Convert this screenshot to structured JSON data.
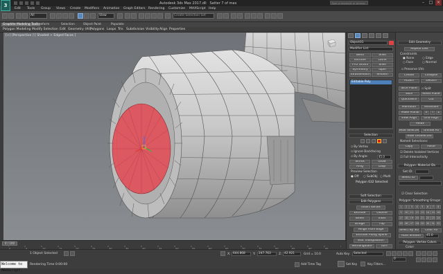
{
  "app": {
    "logo": "3",
    "title": "Autodesk 3ds Max 2017.dll",
    "title_suffix": "Satter 7 of max",
    "search_placeholder": "Type a keyword or phrase",
    "minimize": "–",
    "maximize": "□",
    "close": "×"
  },
  "menu": [
    "Edit",
    "Tools",
    "Group",
    "Views",
    "Create",
    "Modifiers",
    "Animation",
    "Graph Editors",
    "Rendering",
    "Customize",
    "MAXScript",
    "Help"
  ],
  "toolbar": {
    "selection_filter": "All",
    "reference_coord": "View",
    "named_selection": "Create Selection Set"
  },
  "ribbon_tabs": [
    "Graphite Modeling Tools",
    "Freeform",
    "Selection",
    "Object Paint",
    "Populate"
  ],
  "ribbon_sub": [
    "Polygon Modeling",
    "Modify Selection",
    "Edit",
    "Geometry (All)",
    "Polygons",
    "Loops",
    "Tris",
    "Subdivision",
    "Visibility",
    "Align",
    "Properties"
  ],
  "viewport": {
    "label": "[+] [Perspective ] [ Shaded + Edged Faces ]",
    "viewcube_label": "TOP"
  },
  "command_panel": {
    "object_name": "Object01",
    "modifier_list": "Modifier List",
    "modifier_buttons": [
      [
        "Bend",
        "Shell"
      ],
      [
        "Extrude",
        "Lathe"
      ],
      [
        "FFD 3x3x3",
        "Shell"
      ],
      [
        "Symmetry",
        "Taper"
      ],
      [
        "TurboSmooth",
        "Smooth"
      ]
    ],
    "stack_item": "Editable Poly",
    "selection_header": "Selection",
    "by_vertex": "By Vertex",
    "ignore_backfacing": "Ignore Backfacing",
    "by_angle": "By Angle:",
    "by_angle_value": "45.0",
    "shrink": "Shrink",
    "grow": "Grow",
    "ring": "Ring",
    "loop": "Loop",
    "preview_selection": "Preview Selection",
    "off": "Off",
    "subobj": "SubObj",
    "multi": "Multi",
    "selection_status": "Polygon 632 Selected",
    "soft_selection": "Soft Selection",
    "edit_polygons": "Edit Polygons",
    "insert_vertex": "Insert Vertex",
    "extrude": "Extrude",
    "outline": "Outline",
    "bevel": "Bevel",
    "inset": "Inset",
    "bridge": "Bridge",
    "flip": "Flip",
    "hinge": "Hinge From Edge",
    "extrude_spline": "Extrude Along Spline",
    "edit_triangulation": "Edit Triangulation",
    "retriangulate": "Retriangulate",
    "turn": "Turn"
  },
  "right_panel": {
    "edit_geometry": "Edit Geometry",
    "repeat_last": "Repeat Last",
    "constraints": "Constraints",
    "none": "None",
    "edge": "Edge",
    "face": "Face",
    "normal": "Normal",
    "preserve_uvs": "Preserve UVs",
    "create": "Create",
    "collapse": "Collapse",
    "attach": "Attach",
    "detach": "Detach",
    "slice_plane": "Slice Plane",
    "split": "Split",
    "slice": "Slice",
    "reset_plane": "Reset Plane",
    "quickslice": "QuickSlice",
    "cut": "Cut",
    "msmooth": "MSmooth",
    "tessellate": "Tessellate",
    "make_planar": "Make Planar",
    "x": "X",
    "y": "Y",
    "z": "Z",
    "view_align": "View Align",
    "grid_align": "Grid Align",
    "relax": "Relax",
    "hide_selected": "Hide Selected",
    "unhide_all": "Unhide All",
    "hide_unselected": "Hide Unselected",
    "named_selections": "Named Selections:",
    "copy": "Copy",
    "paste": "Paste",
    "delete_isolated": "Delete Isolated Vertices",
    "full_interactivity": "Full Interactivity",
    "material_ids": "Polygon: Material IDs",
    "set_id": "Set ID:",
    "select_id": "Select ID",
    "clear_selection": "Clear Selection",
    "smoothing_groups": "Polygon: Smoothing Groups",
    "select_by_sg": "Select By SG",
    "clear_all": "Clear All",
    "auto_smooth": "Auto Smooth",
    "auto_smooth_value": "45.0",
    "vertex_colors": "Polygon: Vertex Colors",
    "color": "Color:",
    "sg_numbers": [
      "1",
      "2",
      "3",
      "4",
      "5",
      "6",
      "7",
      "8",
      "9",
      "10",
      "11",
      "12",
      "13",
      "14",
      "15",
      "16",
      "17",
      "18",
      "19",
      "20",
      "21",
      "22",
      "23",
      "24",
      "25",
      "26",
      "27",
      "28",
      "29",
      "30",
      "31",
      "32"
    ]
  },
  "timeline": {
    "frame": "0 / 100",
    "ticks": [
      "0",
      "5",
      "10",
      "15",
      "20",
      "25",
      "30",
      "35",
      "40",
      "45",
      "50",
      "55",
      "60",
      "65",
      "70",
      "75",
      "80",
      "85",
      "90",
      "95",
      "100"
    ]
  },
  "status": {
    "maxscript": "Welcome to MAXScript.",
    "selected": "1 Object Selected",
    "rendering": "Rendering Time 0:00:00",
    "x_label": "X:",
    "x_value": "644.868",
    "y_label": "Y:",
    "y_value": "247.763",
    "z_label": "Z:",
    "z_value": "42.921",
    "grid": "Grid = 10.0",
    "auto_key": "Auto Key",
    "selected_dd": "Selected",
    "set_key": "Set Key",
    "key_filters": "Key Filters...",
    "add_time_tag": "Add Time Tag",
    "frame_field": "0"
  },
  "colors": {
    "accent": "#4d7fb8",
    "selected_poly": "#e0515a",
    "mesh": "#c7c7c7"
  }
}
